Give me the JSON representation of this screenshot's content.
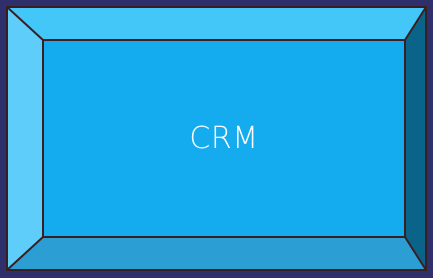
{
  "button": {
    "label": "CRM"
  },
  "colors": {
    "background": "#2e2f6b",
    "face": "#14acef",
    "bevel_top": "#43c6f8",
    "bevel_left": "#5ecdf9",
    "bevel_right": "#0a6489",
    "bevel_bottom": "#2b9fd3",
    "outline": "#3a1f22",
    "text": "#ffffff"
  }
}
